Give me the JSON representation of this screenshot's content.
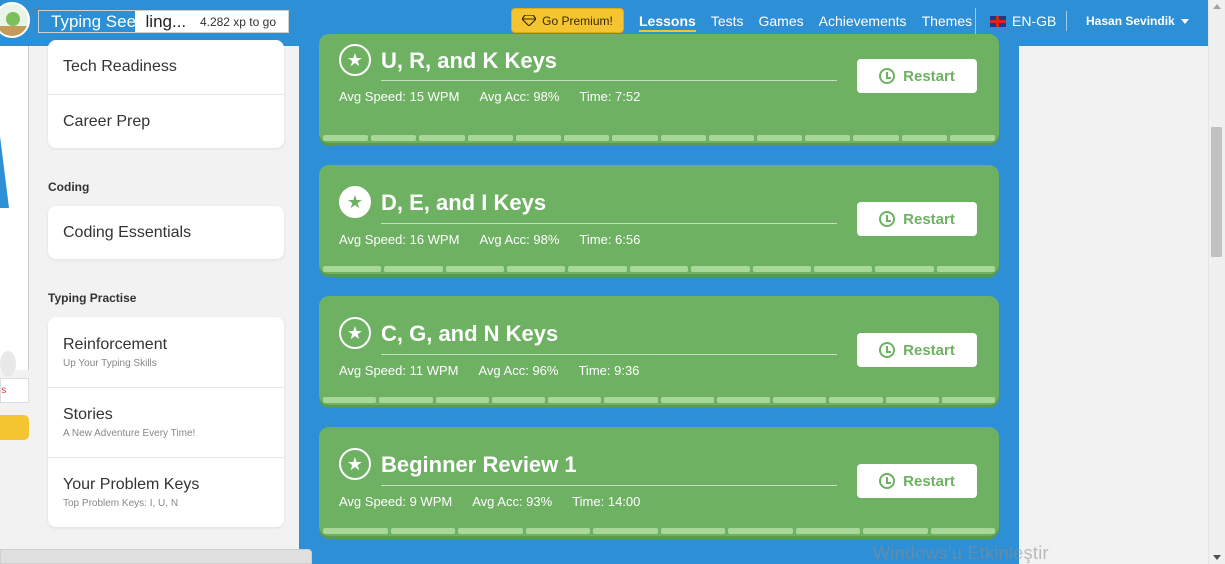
{
  "header": {
    "level_name": "Typing Seedling...",
    "level_name_lit": "Typing Seed",
    "level_name_rest": "ling...",
    "xp_text": "4.282 xp to go",
    "premium_label": "Go Premium!",
    "nav": [
      {
        "label": "Lessons",
        "active": true
      },
      {
        "label": "Tests",
        "active": false
      },
      {
        "label": "Games",
        "active": false
      },
      {
        "label": "Achievements",
        "active": false
      },
      {
        "label": "Themes",
        "active": false
      }
    ],
    "language": "EN-GB",
    "user_name": "Hasan Sevindik",
    "accent_color": "#2d8fd5",
    "premium_color": "#f5c431"
  },
  "left_strip": {
    "red_text": "ls"
  },
  "sidebar": {
    "top_card": [
      {
        "title": "Tech Readiness"
      },
      {
        "title": "Career Prep"
      }
    ],
    "coding_title": "Coding",
    "coding_card": [
      {
        "title": "Coding Essentials"
      }
    ],
    "practise_title": "Typing Practise",
    "practise_card": [
      {
        "title": "Reinforcement",
        "subtitle": "Up Your Typing Skills"
      },
      {
        "title": "Stories",
        "subtitle": "A New Adventure Every Time!"
      },
      {
        "title": "Your Problem Keys",
        "subtitle": "Top Problem Keys: I, U, N"
      }
    ]
  },
  "lessons": [
    {
      "name": "U, R, and K Keys",
      "speed": "Avg Speed: 15 WPM",
      "acc": "Avg Acc: 98%",
      "time": "Time: 7:52",
      "restart": "Restart",
      "star_filled": false,
      "segments": 14
    },
    {
      "name": "D, E, and I Keys",
      "speed": "Avg Speed: 16 WPM",
      "acc": "Avg Acc: 98%",
      "time": "Time: 6:56",
      "restart": "Restart",
      "star_filled": true,
      "segments": 11
    },
    {
      "name": "C, G, and N Keys",
      "speed": "Avg Speed: 11 WPM",
      "acc": "Avg Acc: 96%",
      "time": "Time: 9:36",
      "restart": "Restart",
      "star_filled": false,
      "segments": 12
    },
    {
      "name": "Beginner Review 1",
      "speed": "Avg Speed: 9 WPM",
      "acc": "Avg Acc: 93%",
      "time": "Time: 14:00",
      "restart": "Restart",
      "star_filled": false,
      "segments": 10
    }
  ],
  "lesson_color": "#6eb163",
  "watermark": "Windows'u Etkinleştir"
}
